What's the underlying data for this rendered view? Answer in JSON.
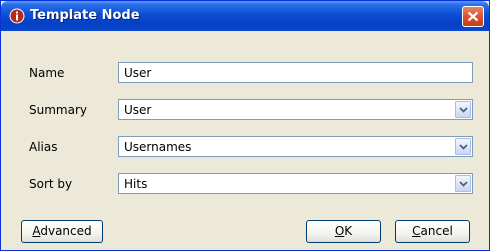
{
  "window": {
    "title": "Template Node",
    "app_icon": "info-icon",
    "close_icon": "close-icon"
  },
  "form": {
    "name_label": "Name",
    "name_value": "User",
    "summary_label": "Summary",
    "summary_value": "User",
    "alias_label": "Alias",
    "alias_value": "Usernames",
    "sort_label": "Sort by",
    "sort_value": "Hits"
  },
  "buttons": {
    "advanced_mnemonic": "A",
    "advanced_rest": "dvanced",
    "ok_mnemonic": "O",
    "ok_rest": "K",
    "cancel_mnemonic": "C",
    "cancel_rest": "ancel"
  },
  "colors": {
    "title_bar": "#0a4fd6",
    "dialog_bg": "#ece9d8",
    "close_button": "#d7542e",
    "field_border": "#7f9db9"
  }
}
